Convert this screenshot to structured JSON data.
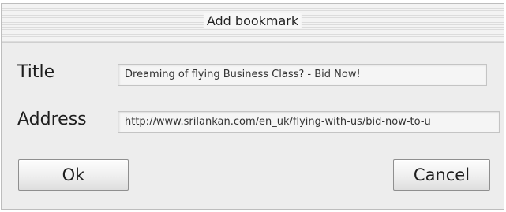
{
  "dialog": {
    "title": "Add bookmark",
    "title_label": "Title",
    "title_value": "Dreaming of flying Business Class? - Bid Now!",
    "address_label": "Address",
    "address_value": "http://www.srilankan.com/en_uk/flying-with-us/bid-now-to-u",
    "ok_label": "Ok",
    "cancel_label": "Cancel"
  }
}
